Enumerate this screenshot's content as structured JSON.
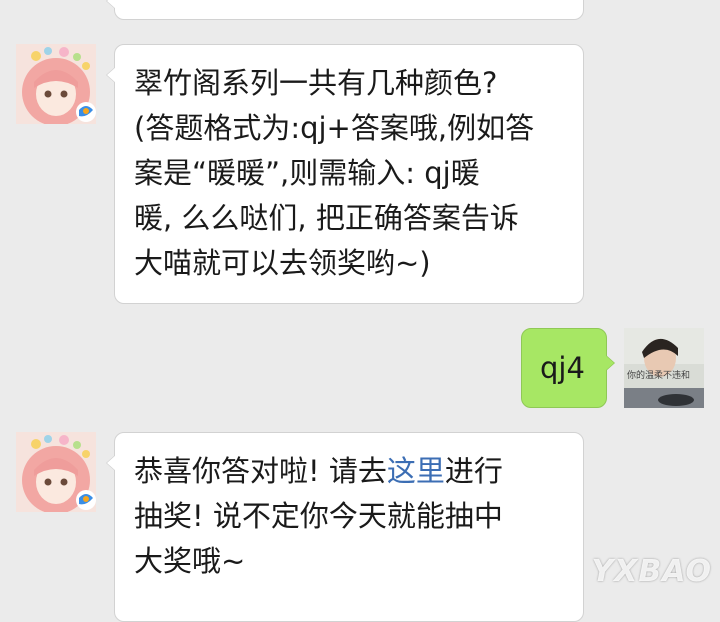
{
  "messages": [
    {
      "sender": "bot",
      "lines": [
        "翠竹阁系列一共有几种颜色?",
        "(答题格式为:qj+答案哦,例如答",
        "案是“暖暖”,则需输入: qj暖",
        "暖, 么么哒们, 把正确答案告诉",
        "大喵就可以去领奖哟~)"
      ]
    },
    {
      "sender": "user",
      "text": "qj4",
      "avatar_caption": "你的温柔不违和"
    },
    {
      "sender": "bot",
      "line1_before": "恭喜你答对啦! 请去",
      "line1_link": "这里",
      "line1_after": "进行",
      "line2": "抽奖! 说不定你今天就能抽中",
      "line3": "大奖哦~"
    }
  ],
  "watermark": "YXBAO",
  "colors": {
    "background": "#ebebeb",
    "incoming_bubble": "#ffffff",
    "outgoing_bubble": "#a7e764",
    "link": "#3c6eb4"
  }
}
